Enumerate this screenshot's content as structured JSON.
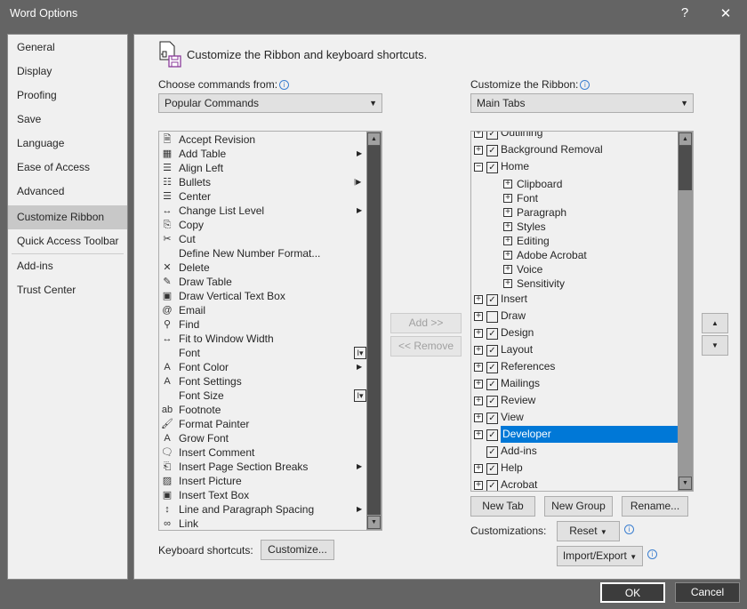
{
  "window": {
    "title": "Word Options",
    "help": "?",
    "close": "✕"
  },
  "sidebar": {
    "items": [
      {
        "label": "General"
      },
      {
        "label": "Display"
      },
      {
        "label": "Proofing"
      },
      {
        "label": "Save"
      },
      {
        "label": "Language"
      },
      {
        "label": "Ease of Access"
      },
      {
        "label": "Advanced"
      },
      {
        "label": "Customize Ribbon",
        "selected": true
      },
      {
        "label": "Quick Access Toolbar"
      },
      {
        "label": "Add-ins"
      },
      {
        "label": "Trust Center"
      }
    ]
  },
  "main": {
    "heading": "Customize the Ribbon and keyboard shortcuts.",
    "choose_label": "Choose commands from:",
    "choose_value": "Popular Commands",
    "ribbon_label": "Customize the Ribbon:",
    "ribbon_value": "Main Tabs",
    "commands": [
      {
        "label": "Accept Revision",
        "icon": "accept-revision-icon",
        "glyph": "🗎"
      },
      {
        "label": "Add Table",
        "icon": "table-icon",
        "glyph": "▦",
        "submenu": "arrow"
      },
      {
        "label": "Align Left",
        "icon": "align-left-icon",
        "glyph": "☰"
      },
      {
        "label": "Bullets",
        "icon": "bullets-icon",
        "glyph": "☷",
        "submenu": "split-arrow"
      },
      {
        "label": "Center",
        "icon": "align-center-icon",
        "glyph": "☰"
      },
      {
        "label": "Change List Level",
        "icon": "list-level-icon",
        "glyph": "↔",
        "submenu": "arrow"
      },
      {
        "label": "Copy",
        "icon": "copy-icon",
        "glyph": "⎘"
      },
      {
        "label": "Cut",
        "icon": "scissors-icon",
        "glyph": "✂"
      },
      {
        "label": "Define New Number Format...",
        "icon": "",
        "glyph": ""
      },
      {
        "label": "Delete",
        "icon": "delete-comment-icon",
        "glyph": "✕"
      },
      {
        "label": "Draw Table",
        "icon": "draw-table-icon",
        "glyph": "✎"
      },
      {
        "label": "Draw Vertical Text Box",
        "icon": "text-box-icon",
        "glyph": "▣"
      },
      {
        "label": "Email",
        "icon": "email-icon",
        "glyph": "@"
      },
      {
        "label": "Find",
        "icon": "search-icon",
        "glyph": "⚲"
      },
      {
        "label": "Fit to Window Width",
        "icon": "fit-width-icon",
        "glyph": "↔"
      },
      {
        "label": "Font",
        "icon": "",
        "glyph": "",
        "submenu": "font-box"
      },
      {
        "label": "Font Color",
        "icon": "font-color-icon",
        "glyph": "A",
        "submenu": "arrow"
      },
      {
        "label": "Font Settings",
        "icon": "font-settings-icon",
        "glyph": "A"
      },
      {
        "label": "Font Size",
        "icon": "",
        "glyph": "",
        "submenu": "font-box"
      },
      {
        "label": "Footnote",
        "icon": "footnote-icon",
        "glyph": "ab"
      },
      {
        "label": "Format Painter",
        "icon": "format-painter-icon",
        "glyph": "🖌"
      },
      {
        "label": "Grow Font",
        "icon": "grow-font-icon",
        "glyph": "A"
      },
      {
        "label": "Insert Comment",
        "icon": "comment-icon",
        "glyph": "🗨"
      },
      {
        "label": "Insert Page  Section Breaks",
        "icon": "page-break-icon",
        "glyph": "⎗",
        "submenu": "arrow"
      },
      {
        "label": "Insert Picture",
        "icon": "picture-icon",
        "glyph": "▨"
      },
      {
        "label": "Insert Text Box",
        "icon": "text-box-icon",
        "glyph": "▣"
      },
      {
        "label": "Line and Paragraph Spacing",
        "icon": "line-spacing-icon",
        "glyph": "↕",
        "submenu": "arrow"
      },
      {
        "label": "Link",
        "icon": "link-icon",
        "glyph": "∞"
      }
    ],
    "add_button": "Add >>",
    "remove_button": "<< Remove",
    "tabs": [
      {
        "label": "Outlining",
        "level": 0,
        "expander": "plus",
        "checked": true
      },
      {
        "label": "Background Removal",
        "level": 0,
        "expander": "plus",
        "checked": true
      },
      {
        "label": "Home",
        "level": 0,
        "expander": "minus",
        "checked": true
      },
      {
        "label": "Clipboard",
        "level": 1,
        "expander": "plus"
      },
      {
        "label": "Font",
        "level": 1,
        "expander": "plus"
      },
      {
        "label": "Paragraph",
        "level": 1,
        "expander": "plus"
      },
      {
        "label": "Styles",
        "level": 1,
        "expander": "plus"
      },
      {
        "label": "Editing",
        "level": 1,
        "expander": "plus"
      },
      {
        "label": "Adobe Acrobat",
        "level": 1,
        "expander": "plus"
      },
      {
        "label": "Voice",
        "level": 1,
        "expander": "plus"
      },
      {
        "label": "Sensitivity",
        "level": 1,
        "expander": "plus"
      },
      {
        "label": "Insert",
        "level": 0,
        "expander": "plus",
        "checked": true
      },
      {
        "label": "Draw",
        "level": 0,
        "expander": "plus",
        "checked": false
      },
      {
        "label": "Design",
        "level": 0,
        "expander": "plus",
        "checked": true
      },
      {
        "label": "Layout",
        "level": 0,
        "expander": "plus",
        "checked": true
      },
      {
        "label": "References",
        "level": 0,
        "expander": "plus",
        "checked": true
      },
      {
        "label": "Mailings",
        "level": 0,
        "expander": "plus",
        "checked": true
      },
      {
        "label": "Review",
        "level": 0,
        "expander": "plus",
        "checked": true
      },
      {
        "label": "View",
        "level": 0,
        "expander": "plus",
        "checked": true
      },
      {
        "label": "Developer",
        "level": 0,
        "expander": "plus",
        "checked": true,
        "selected": true
      },
      {
        "label": "Add-ins",
        "level": 0,
        "expander": "none",
        "checked": true
      },
      {
        "label": "Help",
        "level": 0,
        "expander": "plus",
        "checked": true
      },
      {
        "label": "Acrobat",
        "level": 0,
        "expander": "plus",
        "checked": true
      }
    ],
    "new_tab": "New Tab",
    "new_group": "New Group",
    "rename": "Rename...",
    "customizations_label": "Customizations:",
    "reset": "Reset",
    "import_export": "Import/Export",
    "keyboard_label": "Keyboard shortcuts:",
    "customize_button": "Customize..."
  },
  "footer": {
    "ok": "OK",
    "cancel": "Cancel"
  },
  "colors": {
    "accent": "#0078d7",
    "window": "#646464",
    "panel": "#f0f0f0"
  }
}
